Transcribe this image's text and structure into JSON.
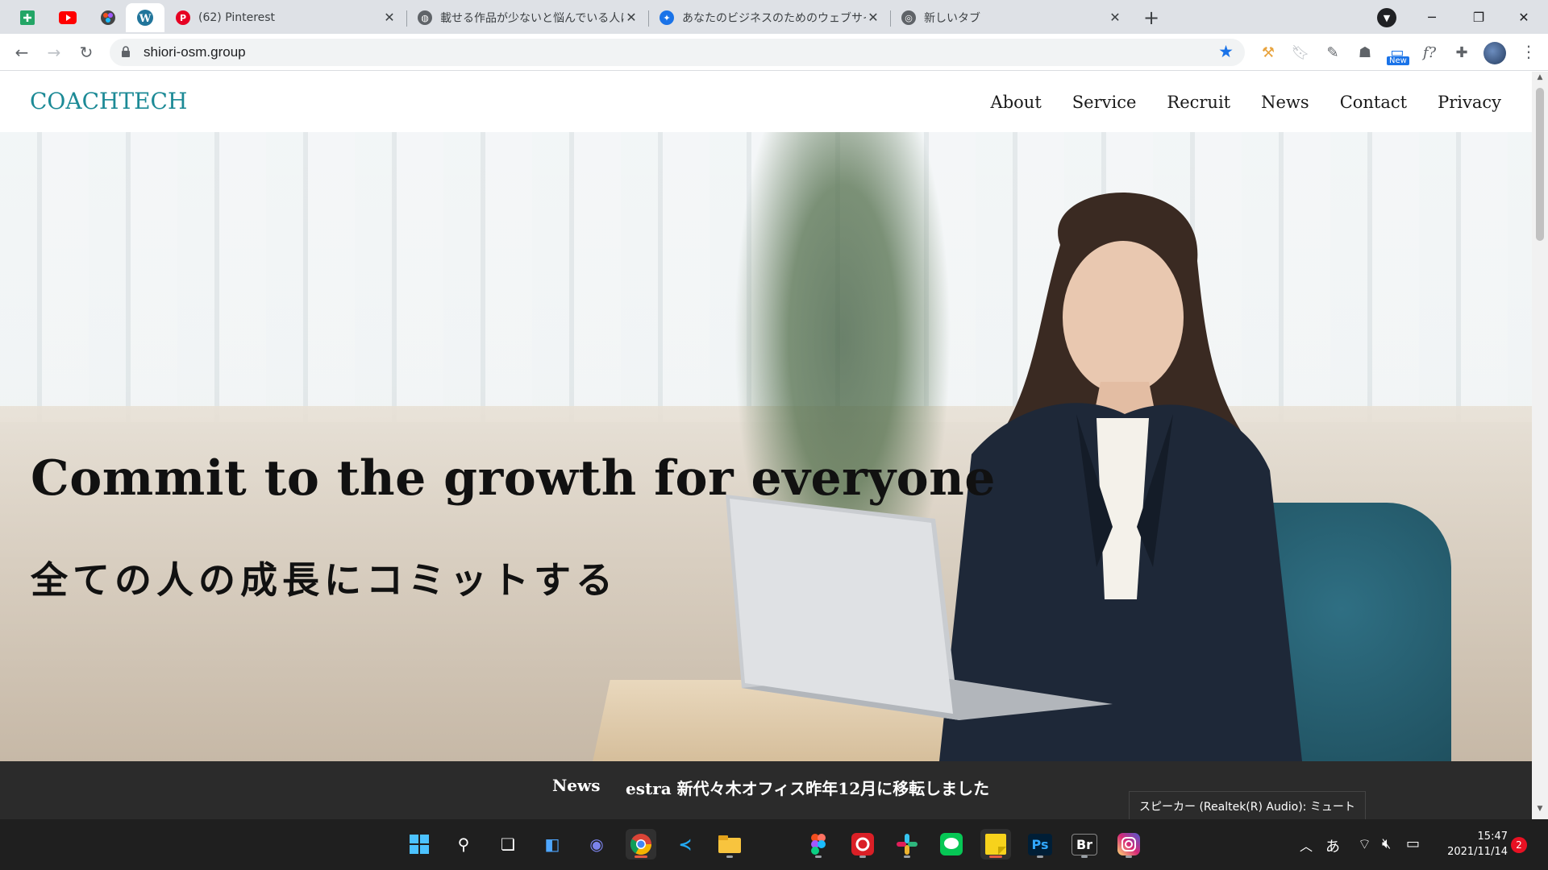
{
  "browser": {
    "tabs": [
      {
        "title": "(62) Pinterest",
        "icon": "pinterest-icon",
        "color": "#e60023"
      },
      {
        "title": "載せる作品が少ないと悩んでいる人に",
        "icon": "globe-icon",
        "color": "#5f6368"
      },
      {
        "title": "あなたのビジネスのためのウェブサイトデ",
        "icon": "bird-icon",
        "color": "#1a73e8"
      },
      {
        "title": "新しいタブ",
        "icon": "chrome-icon",
        "color": "#5f6368"
      }
    ],
    "pinned_tabs": [
      "sheets-icon",
      "youtube-icon",
      "figma-icon",
      "wordpress-icon"
    ],
    "tab_close_glyph": "✕",
    "new_tab_glyph": "+",
    "address": "shiori-osm.group",
    "extension_badge": "New"
  },
  "site": {
    "logo": "COACHTECH",
    "nav": [
      "About",
      "Service",
      "Recruit",
      "News",
      "Contact",
      "Privacy"
    ],
    "hero_en": "Commit to the growth for everyone",
    "hero_ja": "全ての人の成長にコミットする",
    "news_label": "News",
    "news_text": "estra 新代々木オフィス昨年12月に移転しました"
  },
  "tooltip": "スピーカー (Realtek(R) Audio): ミュート",
  "taskbar": {
    "apps": [
      "windows-start-icon",
      "search-icon",
      "task-view-icon",
      "widgets-icon",
      "chat-icon",
      "chrome-icon",
      "vscode-icon",
      "file-explorer-icon",
      "figma-icon",
      "creative-cloud-icon",
      "slack-icon",
      "line-icon",
      "sticky-notes-icon",
      "photoshop-icon",
      "bridge-icon",
      "instagram-icon"
    ],
    "ps_label": "Ps",
    "br_label": "Br",
    "ime": "あ",
    "time": "15:47",
    "date": "2021/11/14",
    "notification_count": "2"
  },
  "colors": {
    "logo": "#1c8a96",
    "newsbar": "#2b2b2b",
    "star": "#1a73e8"
  }
}
